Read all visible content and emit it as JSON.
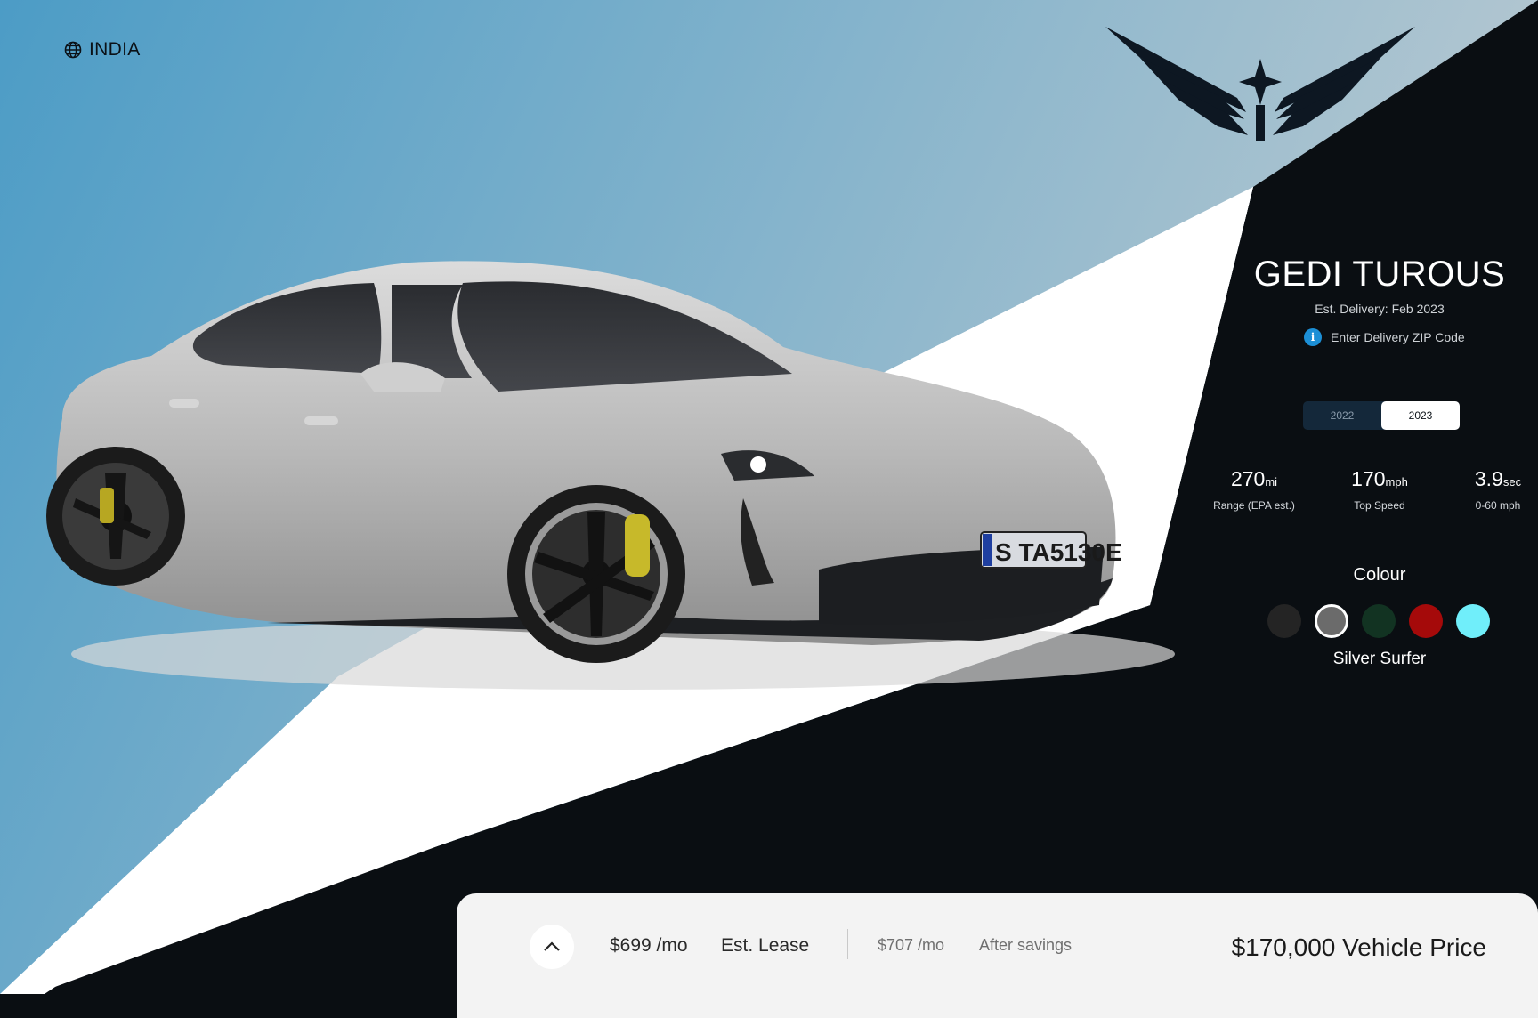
{
  "locale": {
    "label": "INDIA",
    "icon": "globe-icon"
  },
  "brand": {
    "logo_icon": "winged-star-logo-icon"
  },
  "vehicle": {
    "name": "GEDI TUROUS",
    "delivery": "Est. Delivery: Feb 2023",
    "zip_prompt": "Enter Delivery ZIP Code",
    "years": [
      {
        "label": "2022",
        "active": false
      },
      {
        "label": "2023",
        "active": true
      }
    ],
    "specs": [
      {
        "value": "270",
        "unit": "mi",
        "label": "Range (EPA est.)"
      },
      {
        "value": "170",
        "unit": "mph",
        "label": "Top Speed"
      },
      {
        "value": "3.9",
        "unit": "sec",
        "label": "0-60 mph"
      }
    ],
    "colour_title": "Colour",
    "colours": [
      {
        "hex": "#242424",
        "selected": false
      },
      {
        "hex": "#6b6b6b",
        "selected": true
      },
      {
        "hex": "#123322",
        "selected": false
      },
      {
        "hex": "#a50a0a",
        "selected": false
      },
      {
        "hex": "#70eefa",
        "selected": false
      }
    ],
    "selected_colour_name": "Silver Surfer",
    "plate": "S TA5130E"
  },
  "pricing": {
    "lease_price": "$699 /mo",
    "lease_label": "Est. Lease",
    "savings_price": "$707 /mo",
    "savings_label": "After savings",
    "vehicle_price": "$170,000 Vehicle Price"
  },
  "colors": {
    "sky_start": "#4c9cc6",
    "sky_end": "#b9c9d1",
    "dark": "#0a0e12",
    "white_band": "#ffffff",
    "accent_info": "#1c8fd6"
  }
}
